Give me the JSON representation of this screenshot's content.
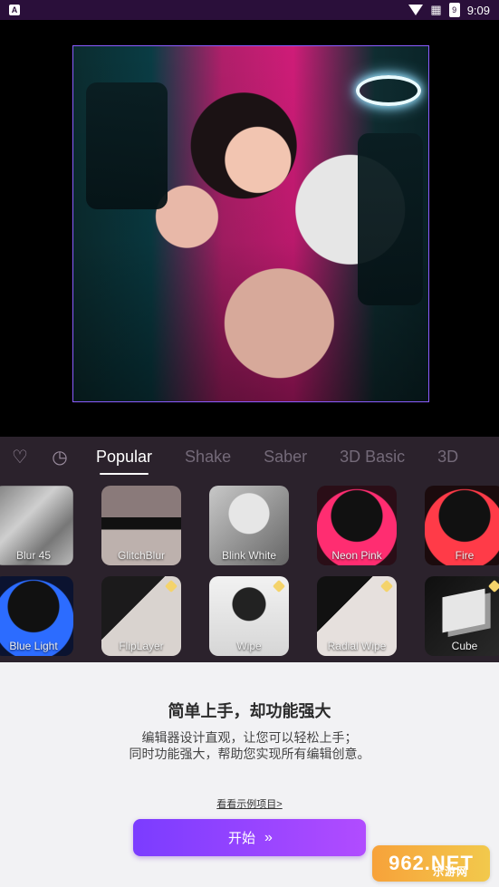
{
  "status": {
    "left_badge": "A",
    "time": "9:09",
    "battery": "9"
  },
  "tabs": [
    "Popular",
    "Shake",
    "Saber",
    "3D Basic",
    "3D"
  ],
  "effects_row1": [
    "Blur 45",
    "GlitchBlur",
    "Blink White",
    "Neon Pink",
    "Fire"
  ],
  "effects_row2": [
    "Blue Light",
    "FlipLayer",
    "Wipe",
    "Radial Wipe",
    "Cube"
  ],
  "bottom": {
    "title": "简单上手，却功能强大",
    "subtitle_line1": "编辑器设计直观，让您可以轻松上手；",
    "subtitle_line2": "同时功能强大，帮助您实现所有编辑创意。",
    "link": "看看示例项目>",
    "start": "开始"
  },
  "watermark": {
    "big": "962.NET",
    "small": "乐游网"
  }
}
